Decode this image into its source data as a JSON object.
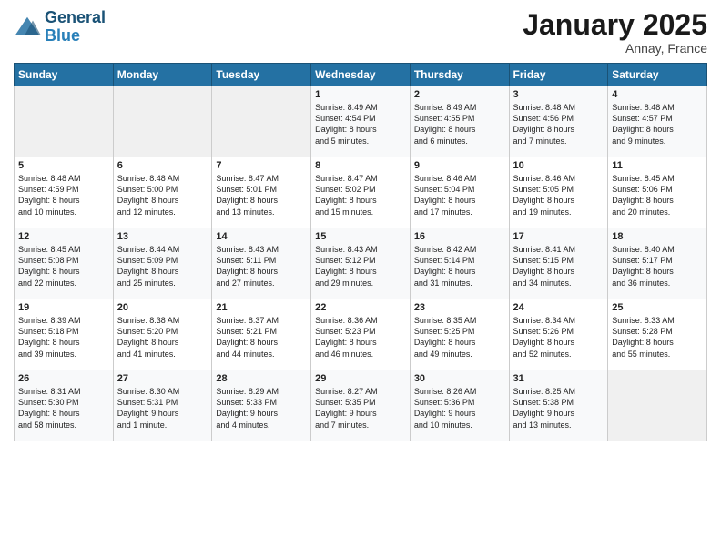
{
  "logo": {
    "line1": "General",
    "line2": "Blue"
  },
  "title": "January 2025",
  "location": "Annay, France",
  "days_header": [
    "Sunday",
    "Monday",
    "Tuesday",
    "Wednesday",
    "Thursday",
    "Friday",
    "Saturday"
  ],
  "weeks": [
    [
      {
        "num": "",
        "info": ""
      },
      {
        "num": "",
        "info": ""
      },
      {
        "num": "",
        "info": ""
      },
      {
        "num": "1",
        "info": "Sunrise: 8:49 AM\nSunset: 4:54 PM\nDaylight: 8 hours\nand 5 minutes."
      },
      {
        "num": "2",
        "info": "Sunrise: 8:49 AM\nSunset: 4:55 PM\nDaylight: 8 hours\nand 6 minutes."
      },
      {
        "num": "3",
        "info": "Sunrise: 8:48 AM\nSunset: 4:56 PM\nDaylight: 8 hours\nand 7 minutes."
      },
      {
        "num": "4",
        "info": "Sunrise: 8:48 AM\nSunset: 4:57 PM\nDaylight: 8 hours\nand 9 minutes."
      }
    ],
    [
      {
        "num": "5",
        "info": "Sunrise: 8:48 AM\nSunset: 4:59 PM\nDaylight: 8 hours\nand 10 minutes."
      },
      {
        "num": "6",
        "info": "Sunrise: 8:48 AM\nSunset: 5:00 PM\nDaylight: 8 hours\nand 12 minutes."
      },
      {
        "num": "7",
        "info": "Sunrise: 8:47 AM\nSunset: 5:01 PM\nDaylight: 8 hours\nand 13 minutes."
      },
      {
        "num": "8",
        "info": "Sunrise: 8:47 AM\nSunset: 5:02 PM\nDaylight: 8 hours\nand 15 minutes."
      },
      {
        "num": "9",
        "info": "Sunrise: 8:46 AM\nSunset: 5:04 PM\nDaylight: 8 hours\nand 17 minutes."
      },
      {
        "num": "10",
        "info": "Sunrise: 8:46 AM\nSunset: 5:05 PM\nDaylight: 8 hours\nand 19 minutes."
      },
      {
        "num": "11",
        "info": "Sunrise: 8:45 AM\nSunset: 5:06 PM\nDaylight: 8 hours\nand 20 minutes."
      }
    ],
    [
      {
        "num": "12",
        "info": "Sunrise: 8:45 AM\nSunset: 5:08 PM\nDaylight: 8 hours\nand 22 minutes."
      },
      {
        "num": "13",
        "info": "Sunrise: 8:44 AM\nSunset: 5:09 PM\nDaylight: 8 hours\nand 25 minutes."
      },
      {
        "num": "14",
        "info": "Sunrise: 8:43 AM\nSunset: 5:11 PM\nDaylight: 8 hours\nand 27 minutes."
      },
      {
        "num": "15",
        "info": "Sunrise: 8:43 AM\nSunset: 5:12 PM\nDaylight: 8 hours\nand 29 minutes."
      },
      {
        "num": "16",
        "info": "Sunrise: 8:42 AM\nSunset: 5:14 PM\nDaylight: 8 hours\nand 31 minutes."
      },
      {
        "num": "17",
        "info": "Sunrise: 8:41 AM\nSunset: 5:15 PM\nDaylight: 8 hours\nand 34 minutes."
      },
      {
        "num": "18",
        "info": "Sunrise: 8:40 AM\nSunset: 5:17 PM\nDaylight: 8 hours\nand 36 minutes."
      }
    ],
    [
      {
        "num": "19",
        "info": "Sunrise: 8:39 AM\nSunset: 5:18 PM\nDaylight: 8 hours\nand 39 minutes."
      },
      {
        "num": "20",
        "info": "Sunrise: 8:38 AM\nSunset: 5:20 PM\nDaylight: 8 hours\nand 41 minutes."
      },
      {
        "num": "21",
        "info": "Sunrise: 8:37 AM\nSunset: 5:21 PM\nDaylight: 8 hours\nand 44 minutes."
      },
      {
        "num": "22",
        "info": "Sunrise: 8:36 AM\nSunset: 5:23 PM\nDaylight: 8 hours\nand 46 minutes."
      },
      {
        "num": "23",
        "info": "Sunrise: 8:35 AM\nSunset: 5:25 PM\nDaylight: 8 hours\nand 49 minutes."
      },
      {
        "num": "24",
        "info": "Sunrise: 8:34 AM\nSunset: 5:26 PM\nDaylight: 8 hours\nand 52 minutes."
      },
      {
        "num": "25",
        "info": "Sunrise: 8:33 AM\nSunset: 5:28 PM\nDaylight: 8 hours\nand 55 minutes."
      }
    ],
    [
      {
        "num": "26",
        "info": "Sunrise: 8:31 AM\nSunset: 5:30 PM\nDaylight: 8 hours\nand 58 minutes."
      },
      {
        "num": "27",
        "info": "Sunrise: 8:30 AM\nSunset: 5:31 PM\nDaylight: 9 hours\nand 1 minute."
      },
      {
        "num": "28",
        "info": "Sunrise: 8:29 AM\nSunset: 5:33 PM\nDaylight: 9 hours\nand 4 minutes."
      },
      {
        "num": "29",
        "info": "Sunrise: 8:27 AM\nSunset: 5:35 PM\nDaylight: 9 hours\nand 7 minutes."
      },
      {
        "num": "30",
        "info": "Sunrise: 8:26 AM\nSunset: 5:36 PM\nDaylight: 9 hours\nand 10 minutes."
      },
      {
        "num": "31",
        "info": "Sunrise: 8:25 AM\nSunset: 5:38 PM\nDaylight: 9 hours\nand 13 minutes."
      },
      {
        "num": "",
        "info": ""
      }
    ]
  ]
}
